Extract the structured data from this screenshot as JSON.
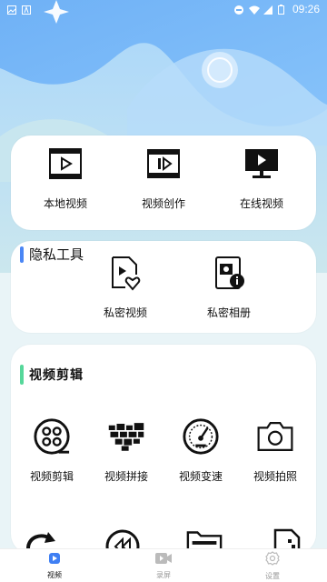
{
  "status_bar": {
    "time": "09:26"
  },
  "main_tools": [
    {
      "label": "本地视频",
      "icon": "film-play-icon"
    },
    {
      "label": "视频创作",
      "icon": "film-edit-icon"
    },
    {
      "label": "在线视频",
      "icon": "monitor-play-icon"
    }
  ],
  "privacy_section": {
    "title": "隐私工具",
    "items": [
      {
        "label": "私密视频",
        "icon": "private-video-icon"
      },
      {
        "label": "私密相册",
        "icon": "private-album-icon"
      }
    ]
  },
  "editing_section": {
    "title": "视频剪辑",
    "items": [
      {
        "label": "视频剪辑",
        "icon": "film-reel-icon"
      },
      {
        "label": "视频拼接",
        "icon": "puzzle-icon"
      },
      {
        "label": "视频变速",
        "icon": "speedometer-icon"
      },
      {
        "label": "视频拍照",
        "icon": "camera-icon"
      }
    ],
    "more_icons": [
      "rotate-icon",
      "rewind-icon",
      "folder-icon",
      "document-icon"
    ]
  },
  "tabs": [
    {
      "label": "视频",
      "icon": "video-tab-icon",
      "active": true
    },
    {
      "label": "录屏",
      "icon": "screen-record-icon",
      "active": false
    },
    {
      "label": "设置",
      "icon": "settings-icon",
      "active": false
    }
  ],
  "colors": {
    "accent_blue": "#4a86f5",
    "accent_green": "#56d79a",
    "bg_top": "#8fc6f8"
  }
}
